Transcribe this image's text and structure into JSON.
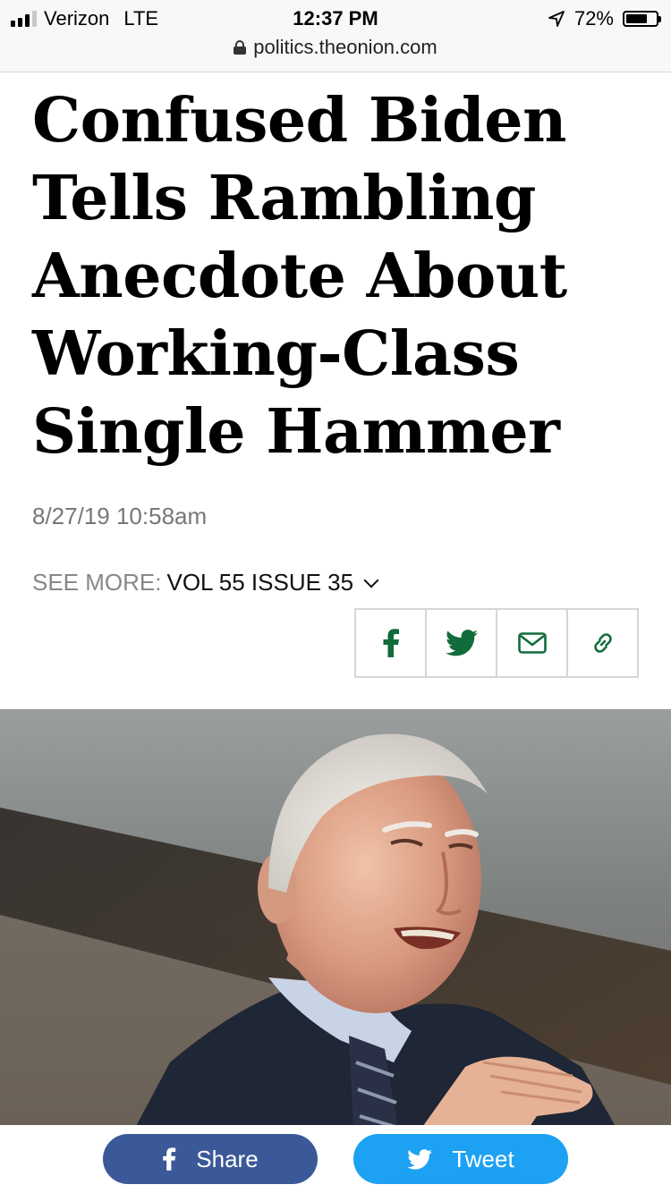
{
  "status": {
    "carrier": "Verizon",
    "network": "LTE",
    "time": "12:37 PM",
    "battery_percent": "72%",
    "battery_level": 0.72,
    "url": "politics.theonion.com"
  },
  "article": {
    "headline": "Confused Biden Tells Rambling Anecdote About Working-Class Single Hammer",
    "date": "8/27/19 10:58am",
    "see_more_label": "SEE MORE:",
    "see_more_value": "VOL 55 ISSUE 35"
  },
  "share_icons": [
    "facebook-icon",
    "twitter-icon",
    "email-icon",
    "link-icon"
  ],
  "bottom_bar": {
    "share_label": "Share",
    "tweet_label": "Tweet"
  },
  "colors": {
    "share_icon_green": "#116b3b",
    "facebook_blue": "#3b5998",
    "twitter_blue": "#1da1f2"
  }
}
